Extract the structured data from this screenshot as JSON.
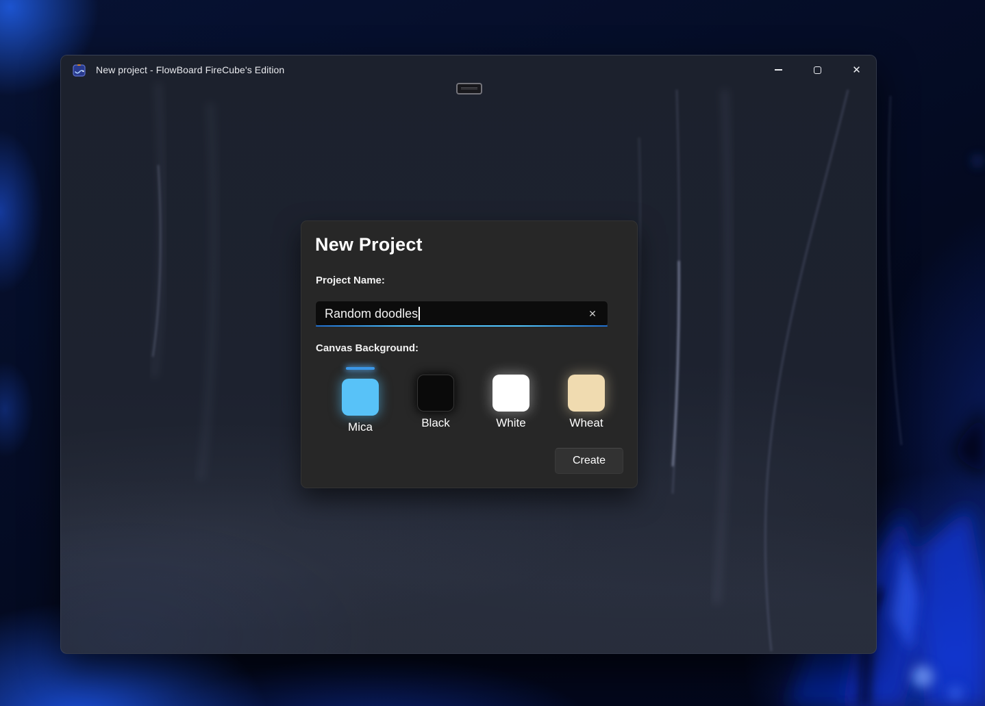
{
  "window": {
    "title": "New project - FlowBoard FireCube's Edition",
    "controls": {
      "close_icon": "✕"
    }
  },
  "dialog": {
    "title": "New Project",
    "project_name": {
      "label": "Project Name:",
      "value": "Random doodles",
      "clear_icon": "✕"
    },
    "canvas_background": {
      "label": "Canvas Background:",
      "options": [
        {
          "label": "Mica",
          "color": "#58c2f8",
          "selected": true
        },
        {
          "label": "Black",
          "color": "#0a0a0a",
          "selected": false
        },
        {
          "label": "White",
          "color": "#ffffff",
          "selected": false
        },
        {
          "label": "Wheat",
          "color": "#f0dbb0",
          "selected": false
        }
      ]
    },
    "create_label": "Create"
  },
  "colors": {
    "accent": "#4ec3ff",
    "selection_indicator": "#3b97e8",
    "dialog_background": "#272727",
    "window_mica": "#1d222f"
  }
}
